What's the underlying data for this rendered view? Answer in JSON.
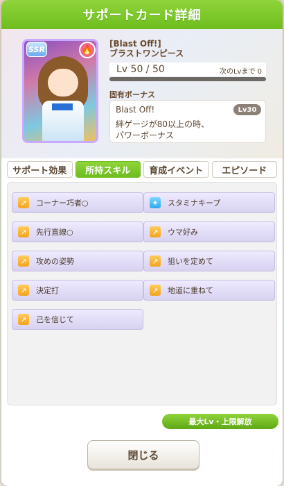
{
  "dialog": {
    "title": "サポートカード詳細"
  },
  "card": {
    "rarity": "SSR",
    "type_icon": "fire-icon",
    "name_en": "[Blast Off!]",
    "name_jp": "ブラストワンピース",
    "level_text": "Lv 50 / 50",
    "next_level_text": "次のLvまで 0",
    "level_progress": 1.0
  },
  "bonus": {
    "section_label": "固有ボーナス",
    "name": "Blast Off!",
    "unlock_level": "Lv30",
    "description_line1": "絆ゲージが80以上の時、",
    "description_line2": "パワーボーナス"
  },
  "tabs": [
    {
      "label": "サポート効果",
      "active": false
    },
    {
      "label": "所持スキル",
      "active": true
    },
    {
      "label": "育成イベント",
      "active": false
    },
    {
      "label": "エピソード",
      "active": false
    }
  ],
  "skills": [
    {
      "name": "コーナー巧者○",
      "icon": "speed-skill-icon",
      "color": "gold"
    },
    {
      "name": "スタミナキープ",
      "icon": "stamina-skill-icon",
      "color": "blue"
    },
    {
      "name": "先行直線○",
      "icon": "speed-skill-icon",
      "color": "gold"
    },
    {
      "name": "ウマ好み",
      "icon": "speed-skill-icon",
      "color": "gold"
    },
    {
      "name": "攻めの姿勢",
      "icon": "speed-skill-icon",
      "color": "gold"
    },
    {
      "name": "狙いを定めて",
      "icon": "speed-skill-icon",
      "color": "gold"
    },
    {
      "name": "決定打",
      "icon": "speed-skill-icon",
      "color": "gold"
    },
    {
      "name": "地道に重ねて",
      "icon": "speed-skill-icon",
      "color": "gold"
    },
    {
      "name": "己を信じて",
      "icon": "speed-skill-icon",
      "color": "gold"
    }
  ],
  "buttons": {
    "max_level_label": "最大Lv・上限解放",
    "close_label": "閉じる"
  }
}
